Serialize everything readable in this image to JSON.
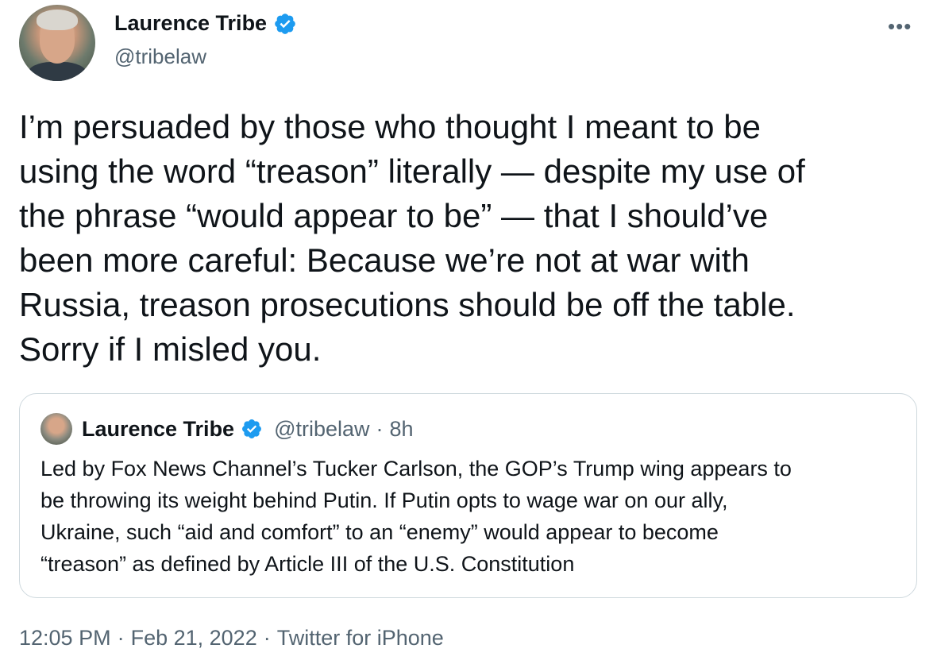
{
  "author": {
    "display_name": "Laurence Tribe",
    "handle": "@tribelaw",
    "verified": true
  },
  "menu_icon": "more-horizontal-icon",
  "tweet_text": "I’m persuaded by those who thought I meant to be\nusing the word “treason” literally — despite my use of\nthe phrase “would appear to be” — that I should’ve\nbeen more careful: Because we’re not at war with\nRussia, treason prosecutions should be off the table.\nSorry if I misled you.",
  "quoted_tweet": {
    "display_name": "Laurence Tribe",
    "handle": "@tribelaw",
    "separator": "·",
    "time": "8h",
    "text": "Led by Fox News Channel’s Tucker Carlson, the GOP’s Trump wing appears to\nbe throwing its weight behind Putin. If Putin opts to wage war on our ally,\nUkraine, such “aid and comfort” to an “enemy” would appear to become\n“treason” as defined by Article III of the U.S. Constitution"
  },
  "footer": {
    "time": "12:05 PM",
    "sep1": "·",
    "date": "Feb 21, 2022",
    "sep2": "·",
    "source": "Twitter for iPhone"
  },
  "colors": {
    "text": "#0f1419",
    "secondary": "#536471",
    "verified": "#1d9bf0",
    "border": "#cfd9de"
  }
}
